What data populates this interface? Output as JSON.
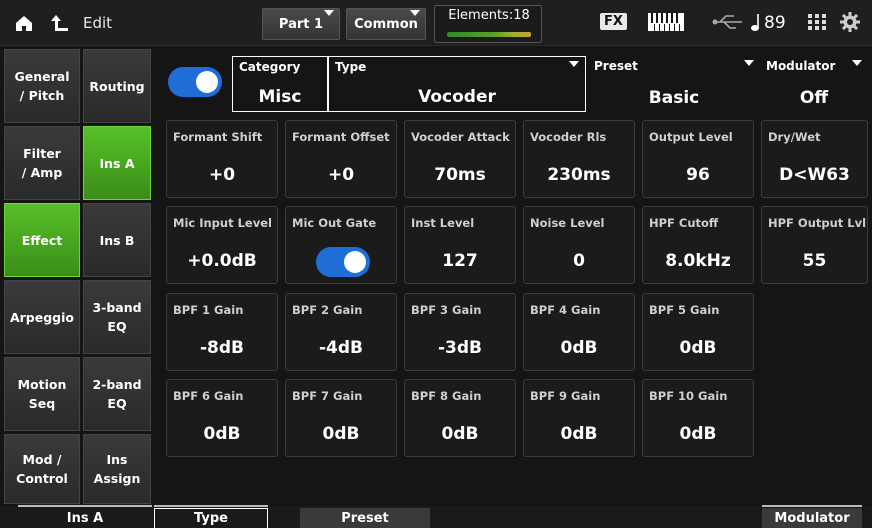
{
  "topbar": {
    "edit_label": "Edit",
    "part_label": "Part 1",
    "common_label": "Common",
    "elements_label": "Elements:18",
    "fx_label": "FX",
    "tempo_value": "89"
  },
  "nav_primary": [
    {
      "label": "General\n/ Pitch",
      "active": false
    },
    {
      "label": "Filter\n/ Amp",
      "active": false
    },
    {
      "label": "Effect",
      "active": true
    },
    {
      "label": "Arpeggio",
      "active": false
    },
    {
      "label": "Motion Seq",
      "active": false
    },
    {
      "label": "Mod /\nControl",
      "active": false
    }
  ],
  "nav_secondary": [
    {
      "label": "Routing",
      "active": false
    },
    {
      "label": "Ins A",
      "active": true
    },
    {
      "label": "Ins B",
      "active": false
    },
    {
      "label": "3-band\nEQ",
      "active": false
    },
    {
      "label": "2-band\nEQ",
      "active": false
    },
    {
      "label": "Ins\nAssign",
      "active": false
    }
  ],
  "header": {
    "switch_on": true,
    "category": {
      "label": "Category",
      "value": "Misc"
    },
    "type": {
      "label": "Type",
      "value": "Vocoder"
    },
    "preset": {
      "label": "Preset",
      "value": "Basic"
    },
    "modulator": {
      "label": "Modulator",
      "value": "Off"
    }
  },
  "params": [
    [
      {
        "label": "Formant Shift",
        "value": "+0"
      },
      {
        "label": "Formant Offset",
        "value": "+0"
      },
      {
        "label": "Vocoder Attack",
        "value": "70ms"
      },
      {
        "label": "Vocoder Rls",
        "value": "230ms"
      },
      {
        "label": "Output Level",
        "value": "96"
      },
      {
        "label": "Dry/Wet",
        "value": "D<W63"
      }
    ],
    [
      {
        "label": "Mic Input Level",
        "value": "+0.0dB"
      },
      {
        "label": "Mic Out Gate",
        "value": "",
        "toggle": true
      },
      {
        "label": "Inst Level",
        "value": "127"
      },
      {
        "label": "Noise Level",
        "value": "0"
      },
      {
        "label": "HPF Cutoff",
        "value": "8.0kHz"
      },
      {
        "label": "HPF Output Lvl",
        "value": "55"
      }
    ],
    [
      {
        "label": "BPF 1 Gain",
        "value": "-8dB"
      },
      {
        "label": "BPF 2 Gain",
        "value": "-4dB"
      },
      {
        "label": "BPF 3 Gain",
        "value": "-3dB"
      },
      {
        "label": "BPF 4 Gain",
        "value": "0dB"
      },
      {
        "label": "BPF 5 Gain",
        "value": "0dB"
      }
    ],
    [
      {
        "label": "BPF 6 Gain",
        "value": "0dB"
      },
      {
        "label": "BPF 7 Gain",
        "value": "0dB"
      },
      {
        "label": "BPF 8 Gain",
        "value": "0dB"
      },
      {
        "label": "BPF 9 Gain",
        "value": "0dB"
      },
      {
        "label": "BPF 10 Gain",
        "value": "0dB"
      }
    ]
  ],
  "bottombar": {
    "ins_a_label": "Ins A",
    "type_label": "Type",
    "preset_label": "Preset",
    "modulator_label": "Modulator"
  },
  "colors": {
    "accent_green": "#4fae22",
    "toggle_blue": "#1f6ed8"
  }
}
